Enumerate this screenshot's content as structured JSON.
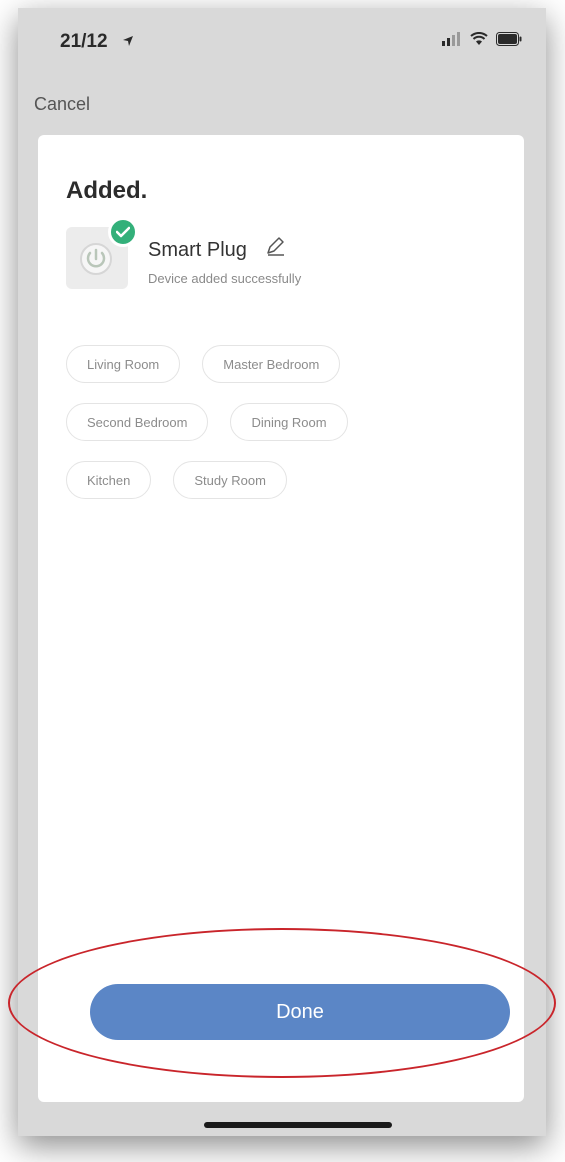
{
  "status_bar": {
    "time": "21/12",
    "icons": [
      "location-arrow-icon",
      "signal-icon",
      "wifi-icon",
      "battery-icon"
    ]
  },
  "nav": {
    "cancel_label": "Cancel"
  },
  "sheet": {
    "title": "Added.",
    "device": {
      "name": "Smart Plug",
      "status": "Device added successfully",
      "icon": "power-plug-icon",
      "badge_icon": "checkmark-icon"
    },
    "rooms": [
      [
        "Living Room",
        "Master Bedroom"
      ],
      [
        "Second Bedroom",
        "Dining Room"
      ],
      [
        "Kitchen",
        "Study Room"
      ]
    ],
    "done_label": "Done"
  },
  "colors": {
    "accent": "#5b86c6",
    "success": "#33b07a",
    "annotation": "#c9252b"
  }
}
